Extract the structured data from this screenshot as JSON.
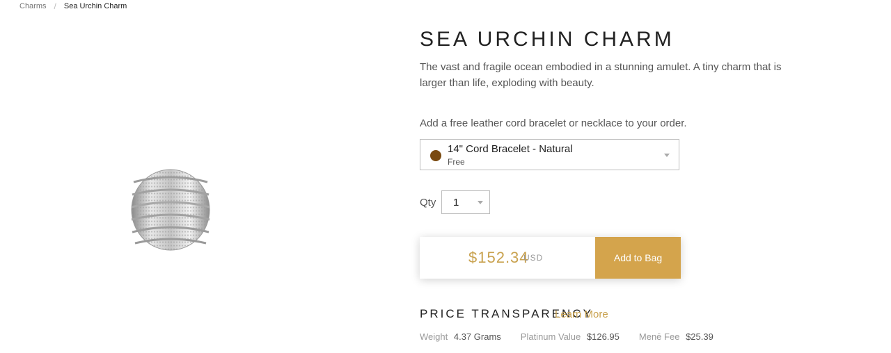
{
  "breadcrumb": {
    "parent": "Charms",
    "separator": "/",
    "current": "Sea Urchin Charm"
  },
  "product": {
    "title": "SEA URCHIN CHARM",
    "description": "The vast and fragile ocean embodied in a stunning amulet. A tiny charm that is larger than life, exploding with beauty."
  },
  "addon": {
    "label": "Add a free leather cord bracelet or necklace to your order.",
    "selected": {
      "name": "14\" Cord Bracelet - Natural",
      "sub": "Free",
      "swatch_color": "#7a4a10"
    }
  },
  "quantity": {
    "label": "Qty",
    "value": "1"
  },
  "purchase": {
    "price": "$152.34",
    "currency": "USD",
    "button": "Add to Bag",
    "accent": "#d4a44c"
  },
  "price_transparency": {
    "heading": "PRICE TRANSPARENCY",
    "learn_more": "Learn More",
    "items": [
      {
        "label": "Weight",
        "value": "4.37 Grams"
      },
      {
        "label": "Platinum Value",
        "value": "$126.95"
      },
      {
        "label": "Menē Fee",
        "value": "$25.39"
      }
    ]
  }
}
